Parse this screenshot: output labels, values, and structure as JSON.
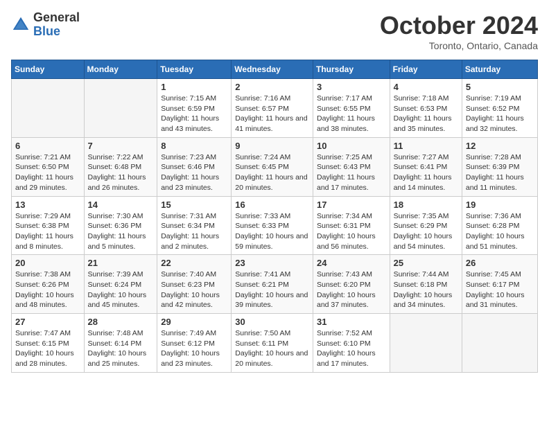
{
  "logo": {
    "general": "General",
    "blue": "Blue"
  },
  "title": "October 2024",
  "subtitle": "Toronto, Ontario, Canada",
  "days_of_week": [
    "Sunday",
    "Monday",
    "Tuesday",
    "Wednesday",
    "Thursday",
    "Friday",
    "Saturday"
  ],
  "weeks": [
    [
      {
        "day": "",
        "info": ""
      },
      {
        "day": "",
        "info": ""
      },
      {
        "day": "1",
        "info": "Sunrise: 7:15 AM\nSunset: 6:59 PM\nDaylight: 11 hours and 43 minutes."
      },
      {
        "day": "2",
        "info": "Sunrise: 7:16 AM\nSunset: 6:57 PM\nDaylight: 11 hours and 41 minutes."
      },
      {
        "day": "3",
        "info": "Sunrise: 7:17 AM\nSunset: 6:55 PM\nDaylight: 11 hours and 38 minutes."
      },
      {
        "day": "4",
        "info": "Sunrise: 7:18 AM\nSunset: 6:53 PM\nDaylight: 11 hours and 35 minutes."
      },
      {
        "day": "5",
        "info": "Sunrise: 7:19 AM\nSunset: 6:52 PM\nDaylight: 11 hours and 32 minutes."
      }
    ],
    [
      {
        "day": "6",
        "info": "Sunrise: 7:21 AM\nSunset: 6:50 PM\nDaylight: 11 hours and 29 minutes."
      },
      {
        "day": "7",
        "info": "Sunrise: 7:22 AM\nSunset: 6:48 PM\nDaylight: 11 hours and 26 minutes."
      },
      {
        "day": "8",
        "info": "Sunrise: 7:23 AM\nSunset: 6:46 PM\nDaylight: 11 hours and 23 minutes."
      },
      {
        "day": "9",
        "info": "Sunrise: 7:24 AM\nSunset: 6:45 PM\nDaylight: 11 hours and 20 minutes."
      },
      {
        "day": "10",
        "info": "Sunrise: 7:25 AM\nSunset: 6:43 PM\nDaylight: 11 hours and 17 minutes."
      },
      {
        "day": "11",
        "info": "Sunrise: 7:27 AM\nSunset: 6:41 PM\nDaylight: 11 hours and 14 minutes."
      },
      {
        "day": "12",
        "info": "Sunrise: 7:28 AM\nSunset: 6:39 PM\nDaylight: 11 hours and 11 minutes."
      }
    ],
    [
      {
        "day": "13",
        "info": "Sunrise: 7:29 AM\nSunset: 6:38 PM\nDaylight: 11 hours and 8 minutes."
      },
      {
        "day": "14",
        "info": "Sunrise: 7:30 AM\nSunset: 6:36 PM\nDaylight: 11 hours and 5 minutes."
      },
      {
        "day": "15",
        "info": "Sunrise: 7:31 AM\nSunset: 6:34 PM\nDaylight: 11 hours and 2 minutes."
      },
      {
        "day": "16",
        "info": "Sunrise: 7:33 AM\nSunset: 6:33 PM\nDaylight: 10 hours and 59 minutes."
      },
      {
        "day": "17",
        "info": "Sunrise: 7:34 AM\nSunset: 6:31 PM\nDaylight: 10 hours and 56 minutes."
      },
      {
        "day": "18",
        "info": "Sunrise: 7:35 AM\nSunset: 6:29 PM\nDaylight: 10 hours and 54 minutes."
      },
      {
        "day": "19",
        "info": "Sunrise: 7:36 AM\nSunset: 6:28 PM\nDaylight: 10 hours and 51 minutes."
      }
    ],
    [
      {
        "day": "20",
        "info": "Sunrise: 7:38 AM\nSunset: 6:26 PM\nDaylight: 10 hours and 48 minutes."
      },
      {
        "day": "21",
        "info": "Sunrise: 7:39 AM\nSunset: 6:24 PM\nDaylight: 10 hours and 45 minutes."
      },
      {
        "day": "22",
        "info": "Sunrise: 7:40 AM\nSunset: 6:23 PM\nDaylight: 10 hours and 42 minutes."
      },
      {
        "day": "23",
        "info": "Sunrise: 7:41 AM\nSunset: 6:21 PM\nDaylight: 10 hours and 39 minutes."
      },
      {
        "day": "24",
        "info": "Sunrise: 7:43 AM\nSunset: 6:20 PM\nDaylight: 10 hours and 37 minutes."
      },
      {
        "day": "25",
        "info": "Sunrise: 7:44 AM\nSunset: 6:18 PM\nDaylight: 10 hours and 34 minutes."
      },
      {
        "day": "26",
        "info": "Sunrise: 7:45 AM\nSunset: 6:17 PM\nDaylight: 10 hours and 31 minutes."
      }
    ],
    [
      {
        "day": "27",
        "info": "Sunrise: 7:47 AM\nSunset: 6:15 PM\nDaylight: 10 hours and 28 minutes."
      },
      {
        "day": "28",
        "info": "Sunrise: 7:48 AM\nSunset: 6:14 PM\nDaylight: 10 hours and 25 minutes."
      },
      {
        "day": "29",
        "info": "Sunrise: 7:49 AM\nSunset: 6:12 PM\nDaylight: 10 hours and 23 minutes."
      },
      {
        "day": "30",
        "info": "Sunrise: 7:50 AM\nSunset: 6:11 PM\nDaylight: 10 hours and 20 minutes."
      },
      {
        "day": "31",
        "info": "Sunrise: 7:52 AM\nSunset: 6:10 PM\nDaylight: 10 hours and 17 minutes."
      },
      {
        "day": "",
        "info": ""
      },
      {
        "day": "",
        "info": ""
      }
    ]
  ]
}
